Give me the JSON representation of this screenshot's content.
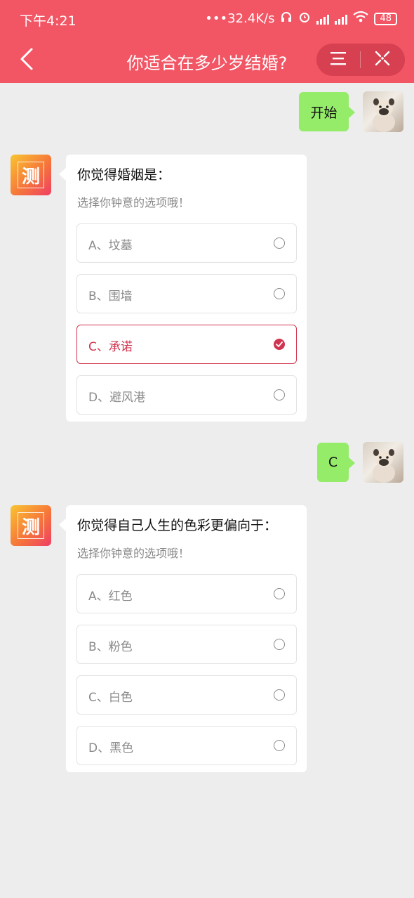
{
  "status_bar": {
    "time": "下午4:21",
    "network_speed": "•••32.4K/s",
    "battery": "48"
  },
  "nav": {
    "title": "你适合在多少岁结婚?"
  },
  "conversation": {
    "start_message": "开始",
    "answer_message": "C",
    "bot_logo_char": "测",
    "q1": {
      "title": "你觉得婚姻是：",
      "subtitle": "选择你钟意的选项哦！",
      "options": [
        {
          "label": "A、坟墓",
          "selected": false
        },
        {
          "label": "B、围墙",
          "selected": false
        },
        {
          "label": "C、承诺",
          "selected": true
        },
        {
          "label": "D、避风港",
          "selected": false
        }
      ]
    },
    "q2": {
      "title": "你觉得自己人生的色彩更偏向于：",
      "subtitle": "选择你钟意的选项哦！",
      "options": [
        {
          "label": "A、红色",
          "selected": false
        },
        {
          "label": "B、粉色",
          "selected": false
        },
        {
          "label": "C、白色",
          "selected": false
        },
        {
          "label": "D、黑色",
          "selected": false
        }
      ]
    }
  },
  "colors": {
    "header": "#f25564",
    "user_bubble": "#95ec69",
    "selected": "#d1344f"
  }
}
